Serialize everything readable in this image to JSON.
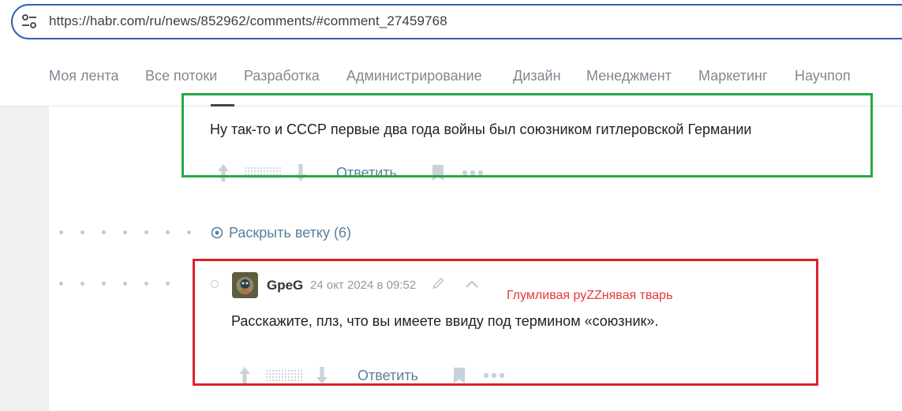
{
  "browser": {
    "url": "https://habr.com/ru/news/852962/comments/#comment_27459768",
    "site_info_icon": "tune-icon"
  },
  "nav": {
    "items": [
      {
        "label": "Моя лента"
      },
      {
        "label": "Все потоки"
      },
      {
        "label": "Разработка"
      },
      {
        "label": "Администрирование"
      },
      {
        "label": "Дизайн"
      },
      {
        "label": "Менеджмент"
      },
      {
        "label": "Маркетинг"
      },
      {
        "label": "Научпоп"
      }
    ]
  },
  "comments": [
    {
      "text": "Ну так-то и СССР первые два года войны был союзником гитлеровской Германии",
      "reply_label": "Ответить"
    },
    {
      "author": "GpeG",
      "timestamp": "24 окт 2024 в 09:52",
      "text": "Расскажите, плз, что вы имеете ввиду под термином «союзник».",
      "reply_label": "Ответить"
    }
  ],
  "thread": {
    "expand_label": "Раскрыть ветку (6)"
  },
  "annotation": {
    "text": "Глумливая руZZнявая тварь"
  },
  "colors": {
    "link": "#5a7f9a",
    "highlight_green": "#27a845",
    "highlight_red": "#d8232a",
    "annotation_red": "#e53935",
    "url_border": "#2f5fb6"
  }
}
